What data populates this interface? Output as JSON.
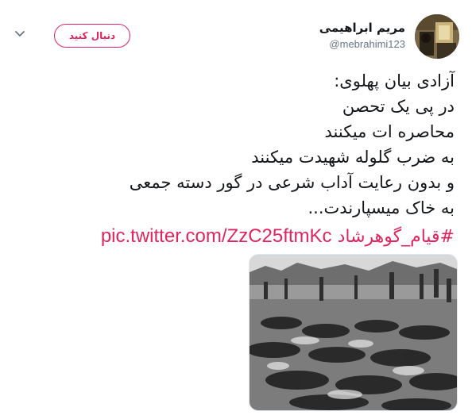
{
  "author": {
    "display_name": "مریم ابراهیمی",
    "handle": "@mebrahimi123",
    "avatar_icon": "avatar-photo"
  },
  "follow_button": {
    "label": "دنبال کنید",
    "color": "#e0245e"
  },
  "menu": {
    "icon": "chevron-down-icon"
  },
  "tweet": {
    "lines": [
      "آزادی بیان پهلوی:",
      "در پی یک تحصن",
      "محاصره ات میکنند",
      "به ضرب گلوله شهیدت میکنند",
      "و بدون رعایت آداب شرعی در گور دسته جمعی",
      "به خاک میسپارندت..."
    ],
    "hashtag": "#قیام_گوهرشاد",
    "pic_link": "pic.twitter.com/ZzC25ftmKc"
  },
  "media": {
    "description_icon": "black-and-white-photo"
  }
}
